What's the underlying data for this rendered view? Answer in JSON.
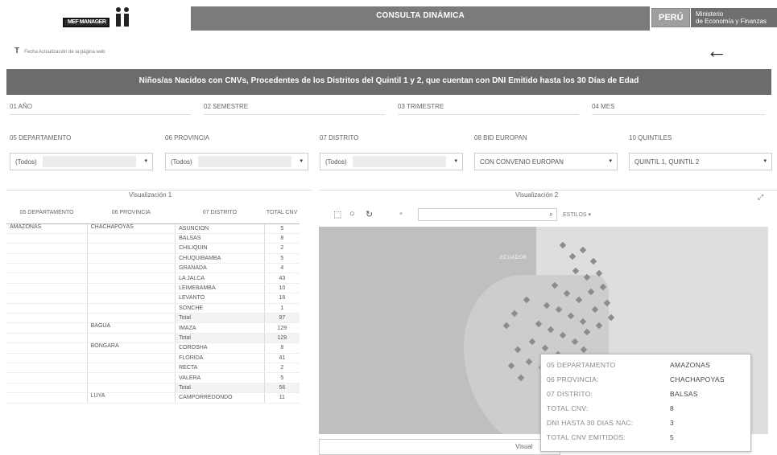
{
  "header": {
    "logo_text": "MEF MANAGER",
    "title": "CONSULTA DINÁMICA",
    "peru": "PERÚ",
    "ministry_line1": "Ministerio",
    "ministry_line2": "de Economía y Finanzas"
  },
  "subnote": "Fecha Actualización de la página web",
  "banner": "Niños/as Nacidos con CNVs, Procedentes de los Distritos del Quintil 1 y 2, que cuentan con DNI Emitido hasta los 30 Días de Edad",
  "filters_row1": [
    "01 AÑO",
    "02 SEMESTRE",
    "03 TRIMESTRE",
    "04 MES"
  ],
  "filters_row2": [
    {
      "label": "05 DEPARTAMENTO",
      "value": "(Todos)"
    },
    {
      "label": "06 PROVINCIA",
      "value": "(Todos)"
    },
    {
      "label": "07 DISTRITO",
      "value": "(Todos)"
    },
    {
      "label": "08 BID EUROPAN",
      "value": "CON CONVENIO EUROPAN"
    },
    {
      "label": "10 QUINTILES",
      "value": "QUINTIL 1, QUINTIL 2"
    }
  ],
  "vis1": {
    "title": "Visualización 1",
    "headers": [
      "05 DEPARTAMENTO",
      "06 PROVINCIA",
      "07 DISTRITO",
      "TOTAL CNV"
    ],
    "rows": [
      {
        "dep": "AMAZONAS",
        "prov": "CHACHAPOYAS",
        "dist": "ASUNCION",
        "total": "5"
      },
      {
        "dep": "",
        "prov": "",
        "dist": "BALSAS",
        "total": "8"
      },
      {
        "dep": "",
        "prov": "",
        "dist": "CHILIQUIN",
        "total": "2"
      },
      {
        "dep": "",
        "prov": "",
        "dist": "CHUQUIBAMBA",
        "total": "5"
      },
      {
        "dep": "",
        "prov": "",
        "dist": "GRANADA",
        "total": "4"
      },
      {
        "dep": "",
        "prov": "",
        "dist": "LA JALCA",
        "total": "43"
      },
      {
        "dep": "",
        "prov": "",
        "dist": "LEIMEBAMBA",
        "total": "10"
      },
      {
        "dep": "",
        "prov": "",
        "dist": "LEVANTO",
        "total": "16"
      },
      {
        "dep": "",
        "prov": "",
        "dist": "SONCHE",
        "total": "1"
      },
      {
        "dep": "",
        "prov": "",
        "dist": "Total",
        "total": "97",
        "total_row": true
      },
      {
        "dep": "",
        "prov": "BAGUA",
        "dist": "IMAZA",
        "total": "129"
      },
      {
        "dep": "",
        "prov": "",
        "dist": "Total",
        "total": "129",
        "total_row": true
      },
      {
        "dep": "",
        "prov": "BONGARA",
        "dist": "COROSHA",
        "total": "8"
      },
      {
        "dep": "",
        "prov": "",
        "dist": "FLORIDA",
        "total": "41"
      },
      {
        "dep": "",
        "prov": "",
        "dist": "RECTA",
        "total": "2"
      },
      {
        "dep": "",
        "prov": "",
        "dist": "VALERA",
        "total": "5"
      },
      {
        "dep": "",
        "prov": "",
        "dist": "Total",
        "total": "56",
        "total_row": true
      },
      {
        "dep": "",
        "prov": "LUYA",
        "dist": "CAMPORREDONDO",
        "total": "11"
      }
    ]
  },
  "vis2": {
    "title": "Visualización 2",
    "estilos": "ESTILOS",
    "map_label": "ECUADOR",
    "footer": "Visual"
  },
  "tooltip": [
    {
      "k": "05 DEPARTAMENTO",
      "v": "AMAZONAS"
    },
    {
      "k": "06 PROVINCIA:",
      "v": "CHACHAPOYAS"
    },
    {
      "k": "07 DISTRITO:",
      "v": "BALSAS"
    },
    {
      "k": "TOTAL CNV:",
      "v": "8"
    },
    {
      "k": "DNI HASTA 30 DIAS NAC:",
      "v": "3"
    },
    {
      "k": "TOTAL CNV EMITIDOS:",
      "v": "5"
    }
  ]
}
